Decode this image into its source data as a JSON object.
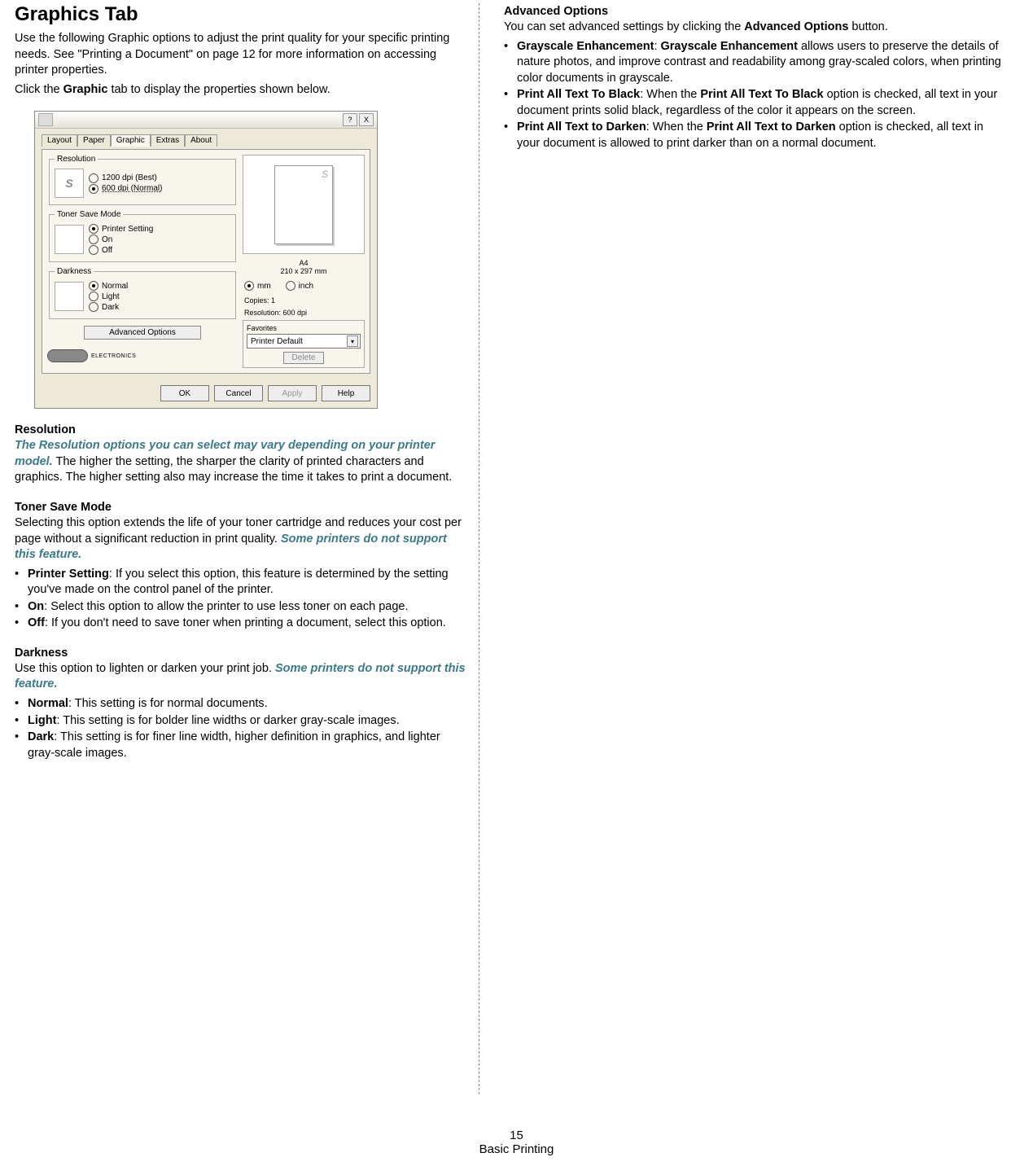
{
  "left": {
    "title": "Graphics Tab",
    "intro1": "Use the following Graphic options to adjust the print quality for your specific printing needs. See \"Printing a Document\" on page 12 for more information on accessing printer properties.",
    "intro2_a": "Click the ",
    "intro2_b": "Graphic",
    "intro2_c": " tab to display the properties shown below.",
    "resolution": {
      "head": "Resolution",
      "note": "The Resolution options you can select may vary depending on your printer model.",
      "rest": " The higher the setting, the sharper the clarity of printed characters and graphics. The higher setting also may increase the time it takes to print a document."
    },
    "toner": {
      "head": "Toner Save Mode",
      "text_a": "Selecting this option extends the life of your toner cartridge and reduces your cost per page without a significant reduction in print quality. ",
      "note": "Some printers do not support this feature.",
      "items": [
        {
          "b": "Printer Setting",
          "t": ": If you select this option, this feature is determined by the setting you've made on the control panel of the printer."
        },
        {
          "b": "On",
          "t": ": Select this option to allow the printer to use less toner on each page."
        },
        {
          "b": "Off",
          "t": ": If you don't need to save toner when printing a document, select this option."
        }
      ]
    },
    "darkness": {
      "head": "Darkness",
      "text_a": "Use this option to lighten or darken your print job.  ",
      "note": "Some printers do not support this feature.",
      "items": [
        {
          "b": "Normal",
          "t": ": This setting is for normal documents."
        },
        {
          "b": "Light",
          "t": ": This setting is for bolder line widths or darker gray-scale images."
        },
        {
          "b": "Dark",
          "t": ": This setting is for finer line width, higher definition in graphics, and lighter gray-scale images."
        }
      ]
    }
  },
  "right": {
    "head": "Advanced Options",
    "intro_a": "You can set advanced settings by clicking the ",
    "intro_b": "Advanced Options",
    "intro_c": " button.",
    "items": [
      {
        "b1": "Grayscale Enhancement",
        "mid": ": ",
        "b2": "Grayscale Enhancement",
        "t": " allows users to preserve the details of nature photos, and improve contrast and readability among gray-scaled colors, when printing color documents in grayscale."
      },
      {
        "b1": "Print All Text To Black",
        "mid": ": When the ",
        "b2": "Print All Text To Black",
        "t": " option is checked, all text in your document prints solid black, regardless of the color it appears on the screen."
      },
      {
        "b1": "Print All Text to Darken",
        "mid": ": When the ",
        "b2": "Print All Text to Darken",
        "t": " option is checked, all text in your document is allowed to print darker than on a normal document."
      }
    ]
  },
  "dialog": {
    "tabs": [
      "Layout",
      "Paper",
      "Graphic",
      "Extras",
      "About"
    ],
    "grp_res": "Resolution",
    "res_opts": [
      "1200 dpi (Best)",
      "600 dpi (Normal)"
    ],
    "grp_toner": "Toner Save Mode",
    "toner_opts": [
      "Printer Setting",
      "On",
      "Off"
    ],
    "grp_dark": "Darkness",
    "dark_opts": [
      "Normal",
      "Light",
      "Dark"
    ],
    "adv_btn": "Advanced Options",
    "paper_lbl": "A4",
    "paper_dim": "210 x 297 mm",
    "unit_mm": "mm",
    "unit_inch": "inch",
    "copies": "Copies: 1",
    "res_line": "Resolution: 600 dpi",
    "fav_lbl": "Favorites",
    "fav_val": "Printer Default",
    "del_btn": "Delete",
    "logo_txt": "ELECTRONICS",
    "btns": [
      "OK",
      "Cancel",
      "Apply",
      "Help"
    ],
    "s": "S",
    "q": "?",
    "x": "X"
  },
  "footer": {
    "page": "15",
    "label": "Basic Printing"
  }
}
